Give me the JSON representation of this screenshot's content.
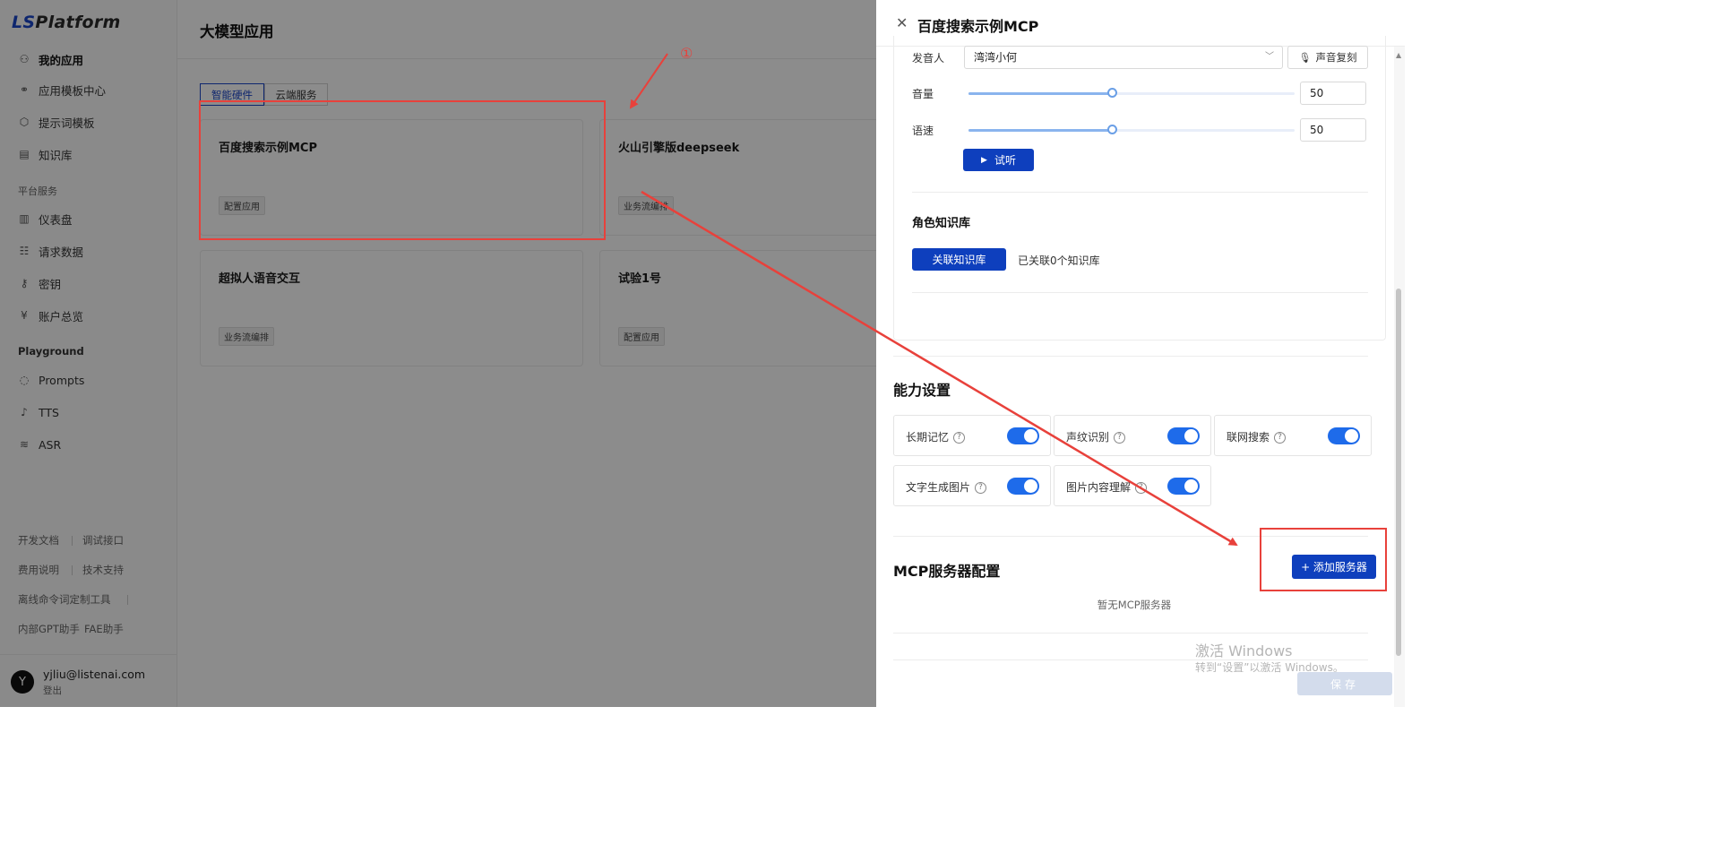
{
  "app": {
    "logo_prefix": "LS",
    "logo_suffix": "Platform"
  },
  "sidebar": {
    "items": [
      {
        "label": "我的应用",
        "icon": "apps-icon"
      },
      {
        "label": "应用模板中心",
        "icon": "template-icon"
      },
      {
        "label": "提示词模板",
        "icon": "cube-icon"
      },
      {
        "label": "知识库",
        "icon": "book-icon"
      }
    ],
    "section_platform": "平台服务",
    "platform_items": [
      {
        "label": "仪表盘",
        "icon": "chart-icon"
      },
      {
        "label": "请求数据",
        "icon": "data-icon"
      },
      {
        "label": "密钥",
        "icon": "key-icon"
      },
      {
        "label": "账户总览",
        "icon": "yuan-icon"
      }
    ],
    "section_playground": "Playground",
    "playground_items": [
      {
        "label": "Prompts",
        "icon": "chat-icon"
      },
      {
        "label": "TTS",
        "icon": "mic-icon"
      },
      {
        "label": "ASR",
        "icon": "wave-icon"
      }
    ],
    "footer_links": [
      "开发文档",
      "调试接口",
      "费用说明",
      "技术支持",
      "离线命令词定制工具",
      "内部GPT助手",
      "FAE助手"
    ],
    "user": {
      "avatar_letter": "Y",
      "email": "yjliu@listenai.com",
      "logout": "登出"
    }
  },
  "main": {
    "title": "大模型应用",
    "tabs": [
      "智能硬件",
      "云端服务"
    ],
    "cards": [
      {
        "title": "百度搜索示例MCP",
        "badge": "配置应用"
      },
      {
        "title": "火山引擎版deepseek",
        "badge": "业务流编排"
      },
      {
        "title": "超拟人语音交互",
        "badge": "业务流编排"
      },
      {
        "title": "试验1号",
        "badge": "配置应用"
      }
    ]
  },
  "drawer": {
    "title": "百度搜索示例MCP",
    "speaker_label": "发音人",
    "speaker_value": "湾湾小何",
    "voice_clone_label": "声音复刻",
    "volume_label": "音量",
    "volume_value": "50",
    "volume_level": 0.44,
    "speed_label": "语速",
    "speed_value": "50",
    "speed_level": 0.44,
    "preview_label": "试听",
    "kb_title": "角色知识库",
    "kb_button": "关联知识库",
    "kb_count": "已关联0个知识库",
    "capability_title": "能力设置",
    "capabilities": [
      {
        "label": "长期记忆",
        "enabled": true
      },
      {
        "label": "声纹识别",
        "enabled": true
      },
      {
        "label": "联网搜索",
        "enabled": true
      },
      {
        "label": "文字生成图片",
        "enabled": true
      },
      {
        "label": "图片内容理解",
        "enabled": true
      }
    ],
    "mcp_title": "MCP服务器配置",
    "add_server": "+ 添加服务器",
    "mcp_empty": "暂无MCP服务器",
    "save": "保存"
  },
  "watermark": {
    "line1": "激活 Windows",
    "line2": "转到“设置”以激活 Windows。"
  },
  "annotation": {
    "marker": "①",
    "color": "#e8413b"
  }
}
